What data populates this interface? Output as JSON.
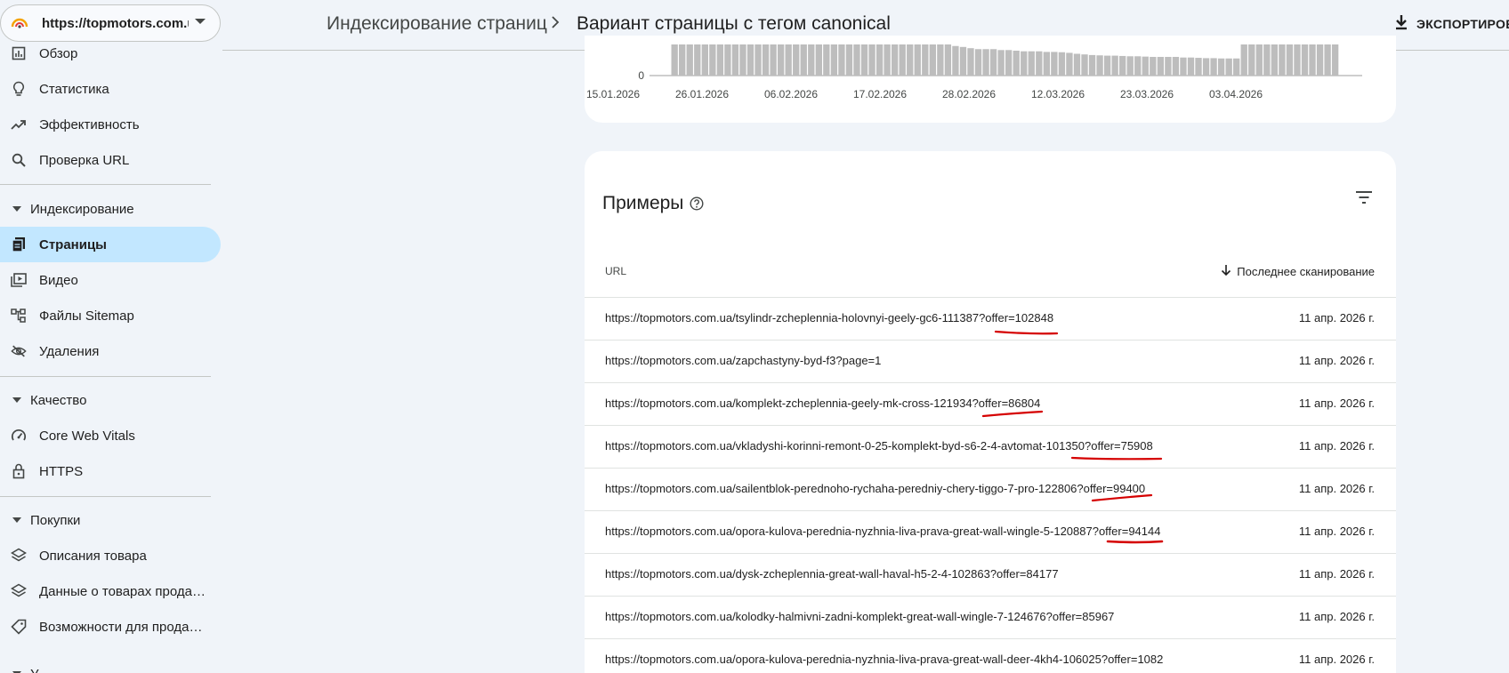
{
  "property": {
    "url": "https://topmotors.com.ua/"
  },
  "sidebar": {
    "items": [
      {
        "label": "Обзор",
        "icon": "overview-icon"
      },
      {
        "label": "Статистика",
        "icon": "lightbulb-icon"
      },
      {
        "label": "Эффективность",
        "icon": "trending-up-icon"
      },
      {
        "label": "Проверка URL",
        "icon": "search-icon"
      }
    ],
    "sections": [
      {
        "label": "Индексирование",
        "items": [
          {
            "label": "Страницы",
            "icon": "pages-icon",
            "active": true
          },
          {
            "label": "Видео",
            "icon": "video-icon"
          },
          {
            "label": "Файлы Sitemap",
            "icon": "sitemap-icon"
          },
          {
            "label": "Удаления",
            "icon": "eye-off-icon"
          }
        ]
      },
      {
        "label": "Качество",
        "items": [
          {
            "label": "Core Web Vitals",
            "icon": "speed-icon"
          },
          {
            "label": "HTTPS",
            "icon": "lock-icon"
          }
        ]
      },
      {
        "label": "Покупки",
        "items": [
          {
            "label": "Описания товара",
            "icon": "layers-icon"
          },
          {
            "label": "Данные о товарах продавца",
            "icon": "layers-icon"
          },
          {
            "label": "Возможности для продавцов",
            "icon": "tag-icon"
          }
        ]
      },
      {
        "label": "У"
      }
    ]
  },
  "header": {
    "crumb_parent": "Индексирование страниц",
    "crumb_current": "Вариант страницы с тегом canonical",
    "export_label": "ЭКСПОРТИРОВАТЬ"
  },
  "chart_data": {
    "type": "bar",
    "y_tick_visible": "0",
    "x_tick_labels": [
      "15.01.2026",
      "26.01.2026",
      "06.02.2026",
      "17.02.2026",
      "28.02.2026",
      "12.03.2026",
      "23.03.2026",
      "03.04.2026"
    ],
    "bar_color": "#bdbdbd",
    "values": [
      100,
      100,
      100,
      100,
      100,
      100,
      100,
      100,
      100,
      100,
      100,
      100,
      100,
      100,
      100,
      100,
      100,
      100,
      100,
      100,
      100,
      100,
      100,
      100,
      100,
      100,
      100,
      100,
      100,
      100,
      100,
      100,
      100,
      100,
      100,
      100,
      100,
      95,
      92,
      88,
      85,
      85,
      85,
      82,
      82,
      80,
      78,
      78,
      78,
      76,
      76,
      75,
      73,
      70,
      68,
      66,
      65,
      64,
      64,
      63,
      62,
      62,
      61,
      60,
      60,
      60,
      60,
      58,
      58,
      57,
      56,
      56,
      55,
      55,
      55,
      100,
      100,
      100,
      100,
      100,
      100,
      100,
      100,
      100,
      100,
      100,
      100,
      100
    ],
    "grid": false
  },
  "examples": {
    "title": "Примеры",
    "col_url": "URL",
    "col_date": "Последнее сканирование",
    "rows": [
      {
        "url": "https://topmotors.com.ua/tsylindr-zcheplennia-holovnyi-geely-gc6-111387?offer=102848",
        "date": "11 апр. 2026 г."
      },
      {
        "url": "https://topmotors.com.ua/zapchastyny-byd-f3?page=1",
        "date": "11 апр. 2026 г."
      },
      {
        "url": "https://topmotors.com.ua/komplekt-zcheplennia-geely-mk-cross-121934?offer=86804",
        "date": "11 апр. 2026 г."
      },
      {
        "url": "https://topmotors.com.ua/vkladyshi-korinni-remont-0-25-komplekt-byd-s6-2-4-avtomat-101350?offer=75908",
        "date": "11 апр. 2026 г."
      },
      {
        "url": "https://topmotors.com.ua/sailentblok-perednoho-rychaha-peredniy-chery-tiggo-7-pro-122806?offer=99400",
        "date": "11 апр. 2026 г."
      },
      {
        "url": "https://topmotors.com.ua/opora-kulova-perednia-nyzhnia-liva-prava-great-wall-wingle-5-120887?offer=94144",
        "date": "11 апр. 2026 г."
      },
      {
        "url": "https://topmotors.com.ua/dysk-zcheplennia-great-wall-haval-h5-2-4-102863?offer=84177",
        "date": "11 апр. 2026 г."
      },
      {
        "url": "https://topmotors.com.ua/kolodky-halmivni-zadni-komplekt-great-wall-wingle-7-124676?offer=85967",
        "date": "11 апр. 2026 г."
      },
      {
        "url": "https://topmotors.com.ua/opora-kulova-perednia-nyzhnia-liva-prava-great-wall-deer-4kh4-106025?offer=1082",
        "date": "11 апр. 2026 г."
      }
    ],
    "annotation_color": "#d50000"
  }
}
